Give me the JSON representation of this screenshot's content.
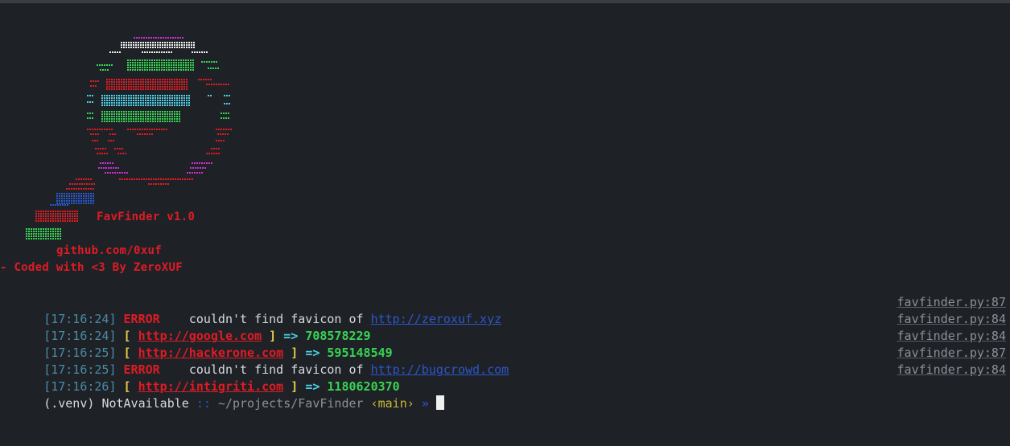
{
  "banner": {
    "title": "FavFinder v1.0",
    "github": "github.com/0xuf",
    "coded_by": "- Coded with <3 By ZeroXUF"
  },
  "log": [
    {
      "time": "[17:16:24]",
      "level": "ERROR",
      "message": "couldn't find favicon of",
      "url": "http://zeroxuf.xyz",
      "source": "favfinder.py:87"
    },
    {
      "time": "[17:16:24]",
      "open": "[",
      "url": "http://google.com",
      "close": "]",
      "arrow": "=>",
      "hash": "708578229",
      "source": "favfinder.py:84"
    },
    {
      "time": "[17:16:25]",
      "open": "[",
      "url": "http://hackerone.com",
      "close": "]",
      "arrow": "=>",
      "hash": "595148549",
      "source": "favfinder.py:84"
    },
    {
      "time": "[17:16:25]",
      "level": "ERROR",
      "message": "couldn't find favicon of",
      "url": "http://bugcrowd.com",
      "source": "favfinder.py:87"
    },
    {
      "time": "[17:16:26]",
      "open": "[",
      "url": "http://intigriti.com",
      "close": "]",
      "arrow": "=>",
      "hash": "1180620370",
      "source": "favfinder.py:84"
    }
  ],
  "prompt": {
    "venv": "(.venv)",
    "host": "NotAvailable",
    "separator": "::",
    "path": "~/projects/FavFinder",
    "branch": "‹main›",
    "symbol": "»"
  },
  "colors": {
    "background": "#1e2227",
    "red": "#e01b24",
    "green": "#39d353",
    "cyan": "#4fd0e6",
    "yellow": "#e5c84a",
    "blue": "#2b56c8",
    "magenta": "#d02fd0"
  },
  "icons": [
    "magnifying-glass-ascii-art-icon"
  ]
}
